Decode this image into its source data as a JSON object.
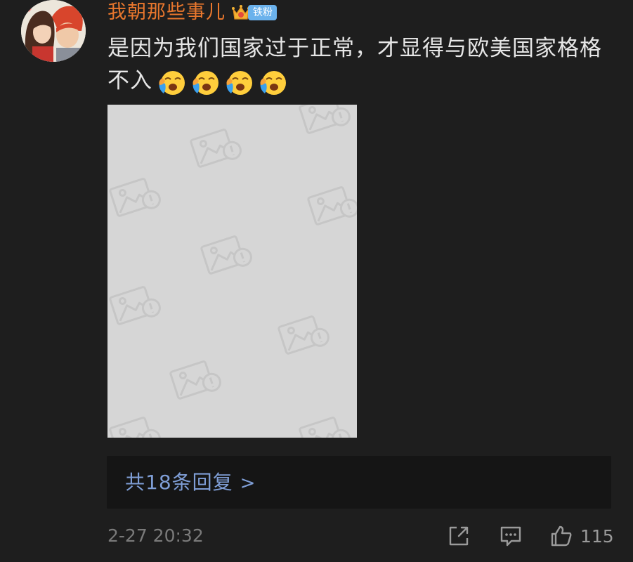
{
  "comment": {
    "username": "我朝那些事儿",
    "badge_label": "铁粉",
    "text": "是因为我们国家过于正常，才显得与欧美国家格格不入",
    "emojis": [
      "laugh-cry-emoji",
      "laugh-cry-emoji",
      "laugh-cry-emoji",
      "laugh-cry-emoji"
    ]
  },
  "replies": {
    "label": "共18条回复",
    "chevron": ">"
  },
  "footer": {
    "timestamp": "2-27 20:32",
    "like_count": "115"
  },
  "colors": {
    "background": "#1e1e1e",
    "username": "#e9772d",
    "badge": "#6bb2ec",
    "reply_link": "#7f9ed6",
    "text": "#e6e6e6",
    "muted": "#7a7a7a"
  }
}
